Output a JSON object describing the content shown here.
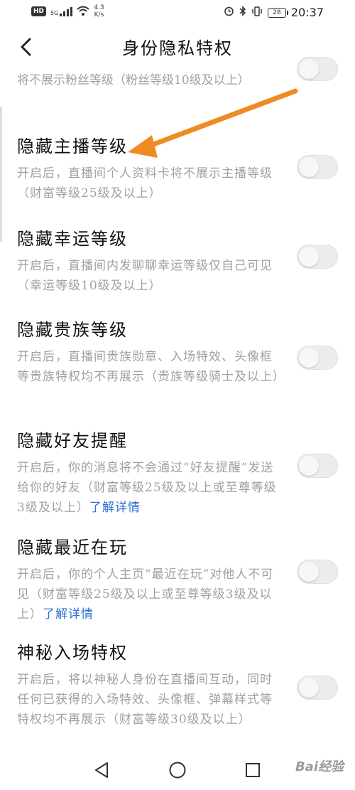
{
  "status_bar": {
    "hd": "HD",
    "network": "5G",
    "speed_value": "4.3",
    "speed_unit": "K/s",
    "battery": "28",
    "time": "20:37"
  },
  "header": {
    "title": "身份隐私特权"
  },
  "partial_desc": "将不展示粉丝等级（粉丝等级10级及以上）",
  "settings": [
    {
      "title": "隐藏主播等级",
      "desc": "开启后，直播间个人资料卡将不展示主播等级（财富等级25级及以上）",
      "link": ""
    },
    {
      "title": "隐藏幸运等级",
      "desc": "开启后，直播间内发聊聊幸运等级仅自己可见（幸运等级10级及以上）",
      "link": ""
    },
    {
      "title": "隐藏贵族等级",
      "desc": "开启后，直播间贵族勋章、入场特效、头像框等贵族特权均不再展示（贵族等级骑士及以上）",
      "link": ""
    },
    {
      "title": "隐藏好友提醒",
      "desc": "开启后，你的消息将不会通过“好友提醒”发送给你的好友（财富等级25级及以上或至尊等级3级及以上）",
      "link": "了解详情"
    },
    {
      "title": "隐藏最近在玩",
      "desc": "开启后，你的个人主页“最近在玩”对他人不可见（财富等级25级及以上或至尊等级3级及以上）",
      "link": "了解详情"
    },
    {
      "title": "神秘入场特权",
      "desc": "开启后，将以神秘人身份在直播间互动，同时任何已获得的入场特效、头像框、弹幕样式等特权均不再展示（财富等级30级及以上）",
      "link": ""
    }
  ],
  "watermark": "Bai经验",
  "colors": {
    "arrow": "#f08a24",
    "link": "#2e6fd1",
    "desc": "#a0a0a0"
  }
}
